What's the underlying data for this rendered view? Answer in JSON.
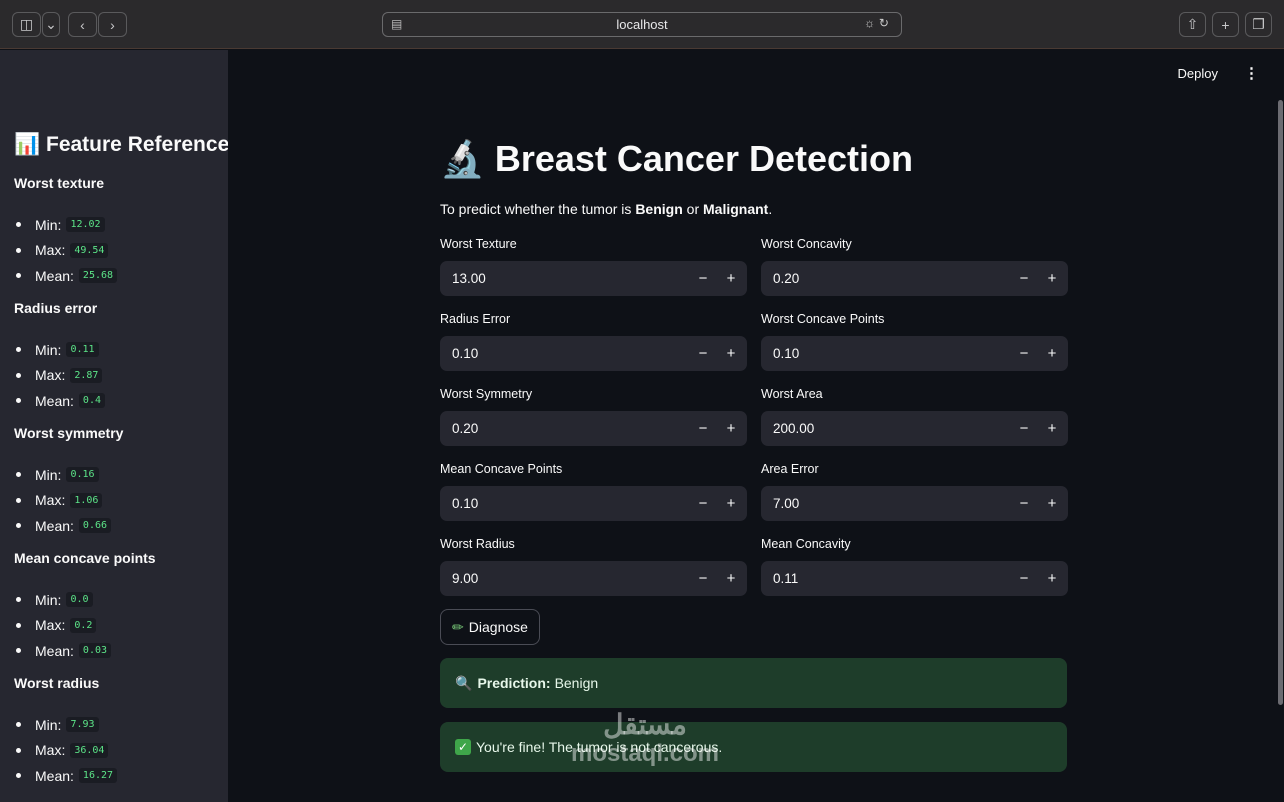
{
  "browser": {
    "url": "localhost"
  },
  "sidebar": {
    "title": "Feature Reference",
    "title_icon": "bar-chart-icon",
    "sections": [
      {
        "name": "Worst texture",
        "items": [
          {
            "label": "Min:",
            "value": "12.02"
          },
          {
            "label": "Max:",
            "value": "49.54"
          },
          {
            "label": "Mean:",
            "value": "25.68"
          }
        ]
      },
      {
        "name": "Radius error",
        "items": [
          {
            "label": "Min:",
            "value": "0.11"
          },
          {
            "label": "Max:",
            "value": "2.87"
          },
          {
            "label": "Mean:",
            "value": "0.4"
          }
        ]
      },
      {
        "name": "Worst symmetry",
        "items": [
          {
            "label": "Min:",
            "value": "0.16"
          },
          {
            "label": "Max:",
            "value": "1.06"
          },
          {
            "label": "Mean:",
            "value": "0.66"
          }
        ]
      },
      {
        "name": "Mean concave points",
        "items": [
          {
            "label": "Min:",
            "value": "0.0"
          },
          {
            "label": "Max:",
            "value": "0.2"
          },
          {
            "label": "Mean:",
            "value": "0.03"
          }
        ]
      },
      {
        "name": "Worst radius",
        "items": [
          {
            "label": "Min:",
            "value": "7.93"
          },
          {
            "label": "Max:",
            "value": "36.04"
          },
          {
            "label": "Mean:",
            "value": "16.27"
          }
        ]
      }
    ]
  },
  "header": {
    "deploy_label": "Deploy"
  },
  "main": {
    "title": "Breast Cancer Detection",
    "title_icon": "microscope-icon",
    "subtitle_prefix": "To predict whether the tumor is ",
    "subtitle_benign": "Benign",
    "subtitle_or": " or ",
    "subtitle_malignant": "Malignant",
    "subtitle_suffix": ".",
    "fields": [
      {
        "label": "Worst Texture",
        "value": "13.00"
      },
      {
        "label": "Worst Concavity",
        "value": "0.20"
      },
      {
        "label": "Radius Error",
        "value": "0.10"
      },
      {
        "label": "Worst Concave Points",
        "value": "0.10"
      },
      {
        "label": "Worst Symmetry",
        "value": "0.20"
      },
      {
        "label": "Worst Area",
        "value": "200.00"
      },
      {
        "label": "Mean Concave Points",
        "value": "0.10"
      },
      {
        "label": "Area Error",
        "value": "7.00"
      },
      {
        "label": "Worst Radius",
        "value": "9.00"
      },
      {
        "label": "Mean Concavity",
        "value": "0.11"
      }
    ],
    "diagnose_label": "Diagnose",
    "diagnose_icon": "test-tube-icon",
    "prediction_label": "Prediction:",
    "prediction_value": "Benign",
    "prediction_icon": "magnifier-icon",
    "result_text": "You're fine! The tumor is not cancerous.",
    "result_icon": "check-icon"
  },
  "watermark": {
    "arabic": "مستقل",
    "latin": "mostaql.com"
  }
}
